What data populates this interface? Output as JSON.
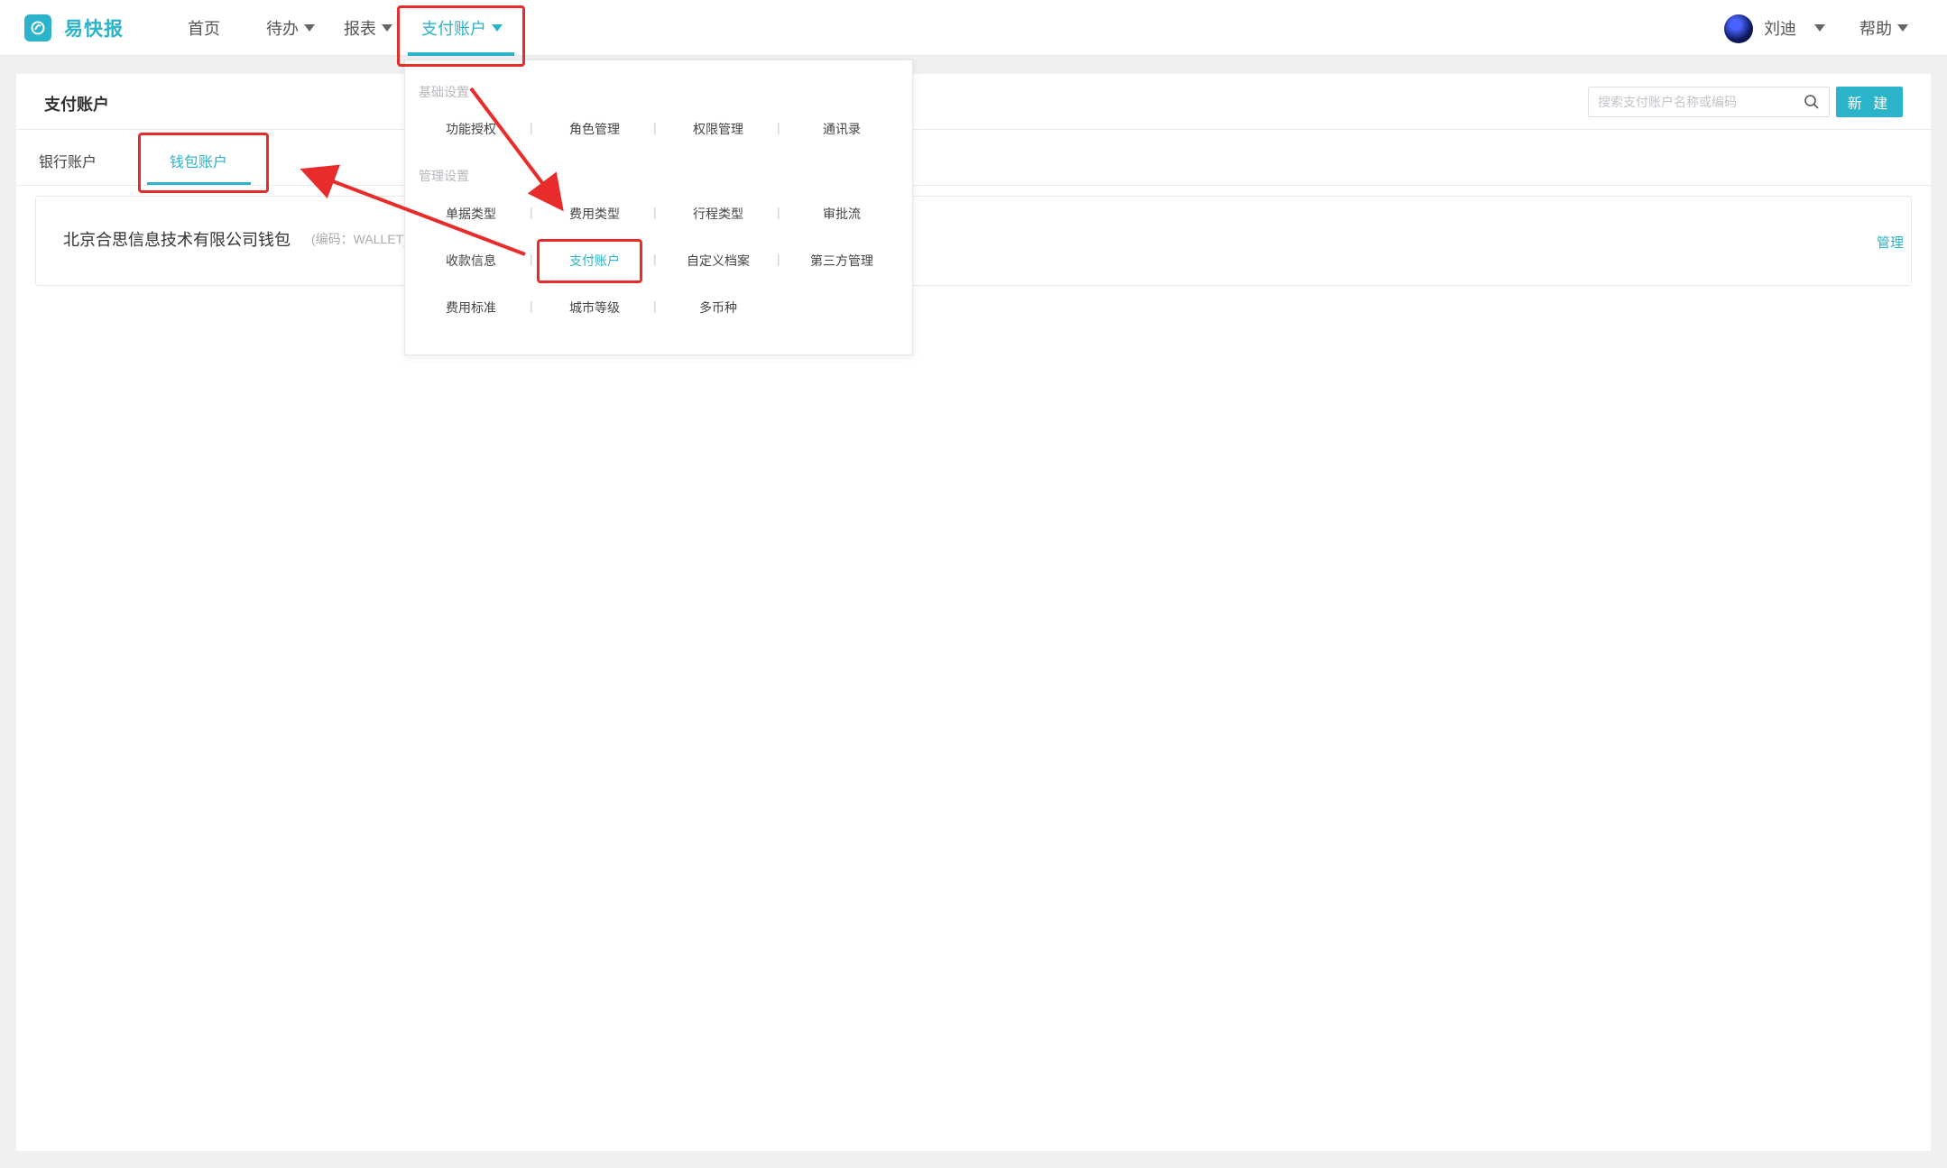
{
  "brand": {
    "name": "易快报",
    "accent": "#2bb3c9"
  },
  "nav": {
    "home": "首页",
    "todo": "待办",
    "reports": "报表",
    "pay_accounts": "支付账户",
    "user": "刘迪",
    "help": "帮助"
  },
  "panel": {
    "title": "支付账户",
    "search_placeholder": "搜索支付账户名称或编码",
    "new_label": "新 建"
  },
  "tabs": {
    "bank": "银行账户",
    "wallet": "钱包账户",
    "active": "钱包账户"
  },
  "accounts": [
    {
      "name": "北京合思信息技术有限公司钱包",
      "code": "(编码：WALLET)",
      "action": "管理"
    }
  ],
  "dropdown": {
    "basic_group": "基础设置",
    "basic_items": [
      "功能授权",
      "角色管理",
      "权限管理",
      "通讯录"
    ],
    "manage_group": "管理设置",
    "manage_rows": [
      [
        "单据类型",
        "费用类型",
        "行程类型",
        "审批流"
      ],
      [
        "收款信息",
        "支付账户",
        "自定义档案",
        "第三方管理"
      ],
      [
        "费用标准",
        "城市等级",
        "多币种"
      ]
    ],
    "active_item": "支付账户"
  },
  "annotation_color": "#e82c2c"
}
